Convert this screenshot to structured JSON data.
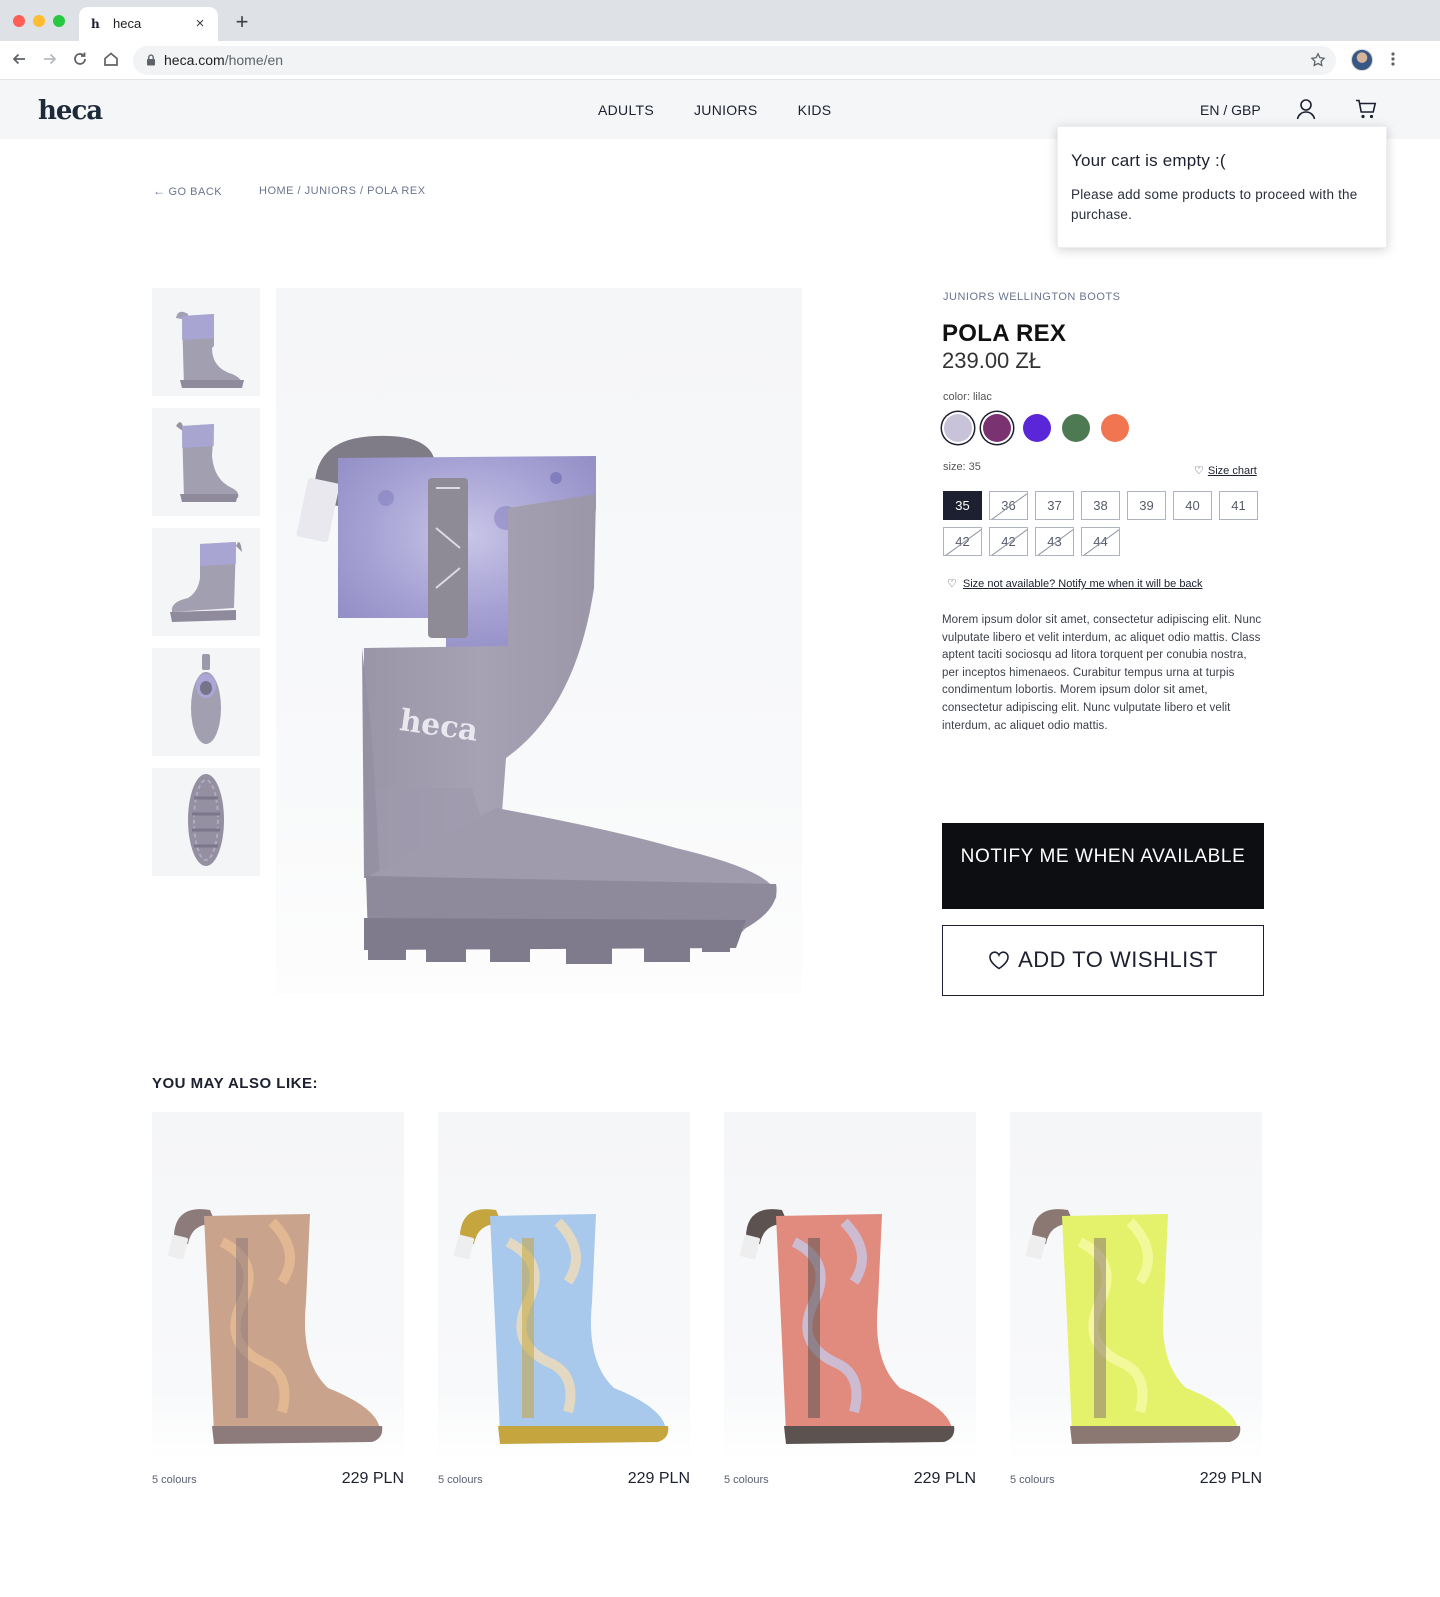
{
  "browser": {
    "tab_title": "heca",
    "tab_favicon": "h",
    "url_host": "heca.com",
    "url_path": "/home/en",
    "new_tab_label": "+",
    "tab_close_label": "×"
  },
  "header": {
    "logo": "heca",
    "nav": [
      "ADULTS",
      "JUNIORS",
      "KIDS"
    ],
    "locale": "EN / GBP",
    "icons": [
      "user-icon",
      "cart-icon"
    ]
  },
  "cart_popup": {
    "title": "Your cart is empty :(",
    "message": "Please add some products to proceed with the purchase."
  },
  "breadcrumb": {
    "back": "GO BACK",
    "path": "HOME / JUNIORS / POLA REX"
  },
  "product": {
    "category": "JUNIORS WELLINGTON BOOTS",
    "name": "POLA REX",
    "price": "239.00 ZŁ",
    "color_label": "color: lilac",
    "colors": [
      "#c9c3da",
      "#7a3370",
      "#5b25d8",
      "#4d7a52",
      "#f27552"
    ],
    "selected_color_index": 1,
    "size_label": "size: 35",
    "size_chart": "Size chart",
    "sizes": [
      {
        "label": "35",
        "state": "selected"
      },
      {
        "label": "36",
        "state": "unavailable"
      },
      {
        "label": "37",
        "state": "available"
      },
      {
        "label": "38",
        "state": "available"
      },
      {
        "label": "39",
        "state": "available"
      },
      {
        "label": "40",
        "state": "available"
      },
      {
        "label": "41",
        "state": "available"
      },
      {
        "label": "42",
        "state": "unavailable"
      },
      {
        "label": "42",
        "state": "unavailable"
      },
      {
        "label": "43",
        "state": "unavailable"
      },
      {
        "label": "44",
        "state": "unavailable"
      }
    ],
    "notify_link": "Size not available? Notify me when it will be back",
    "description": "Morem ipsum dolor sit amet, consectetur adipiscing elit. Nunc vulputate libero et velit interdum, ac aliquet odio mattis. Class aptent taciti sociosqu ad litora torquent per conubia nostra, per inceptos himenaeos. Curabitur tempus urna at turpis condimentum lobortis. Morem ipsum dolor sit amet, consectetur adipiscing elit. Nunc vulputate libero et velit interdum, ac aliquet odio mattis.",
    "notify_button": "NOTIFY ME WHEN AVAILABLE",
    "wishlist_button": "ADD TO WISHLIST",
    "boot_logo": "heca"
  },
  "recommendations": {
    "title": "YOU MAY ALSO LIKE:",
    "items": [
      {
        "colours": "5 colours",
        "price": "229 PLN",
        "color_main": "#c9a38c",
        "color_pattern": "#e9bd94",
        "color_sole": "#8d7a7a"
      },
      {
        "colours": "5 colours",
        "price": "229 PLN",
        "color_main": "#a8c8ec",
        "color_pattern": "#f1ddb8",
        "color_sole": "#c4a53e"
      },
      {
        "colours": "5 colours",
        "price": "229 PLN",
        "color_main": "#e18a7e",
        "color_pattern": "#c7c7e6",
        "color_sole": "#5c5350"
      },
      {
        "colours": "5 colours",
        "price": "229 PLN",
        "color_main": "#e4f16b",
        "color_pattern": "#f6fba8",
        "color_sole": "#8c7873"
      }
    ]
  }
}
